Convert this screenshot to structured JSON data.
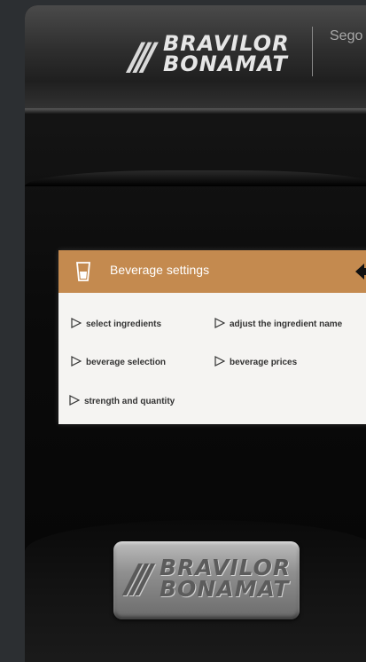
{
  "brand": {
    "logo_line1": "BRAVILOR",
    "logo_line2": "BONAMAT",
    "logo_bars": "///",
    "side_text": "Sego"
  },
  "screen": {
    "title": "Beverage settings",
    "header_color": "#c48a4f",
    "menu_items": [
      {
        "label": "select ingredients"
      },
      {
        "label": "adjust the ingredient name"
      },
      {
        "label": "beverage selection"
      },
      {
        "label": "beverage prices"
      },
      {
        "label": "strength and quantity"
      }
    ]
  },
  "badge": {
    "line1": "BRAVILOR",
    "line2": "BONAMAT",
    "bars": "///"
  }
}
